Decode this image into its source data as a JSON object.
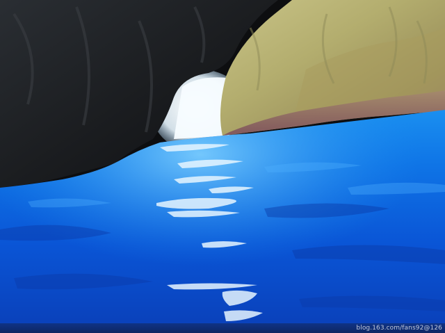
{
  "photo": {
    "watermark": "blog.163.com/fans92@126"
  }
}
